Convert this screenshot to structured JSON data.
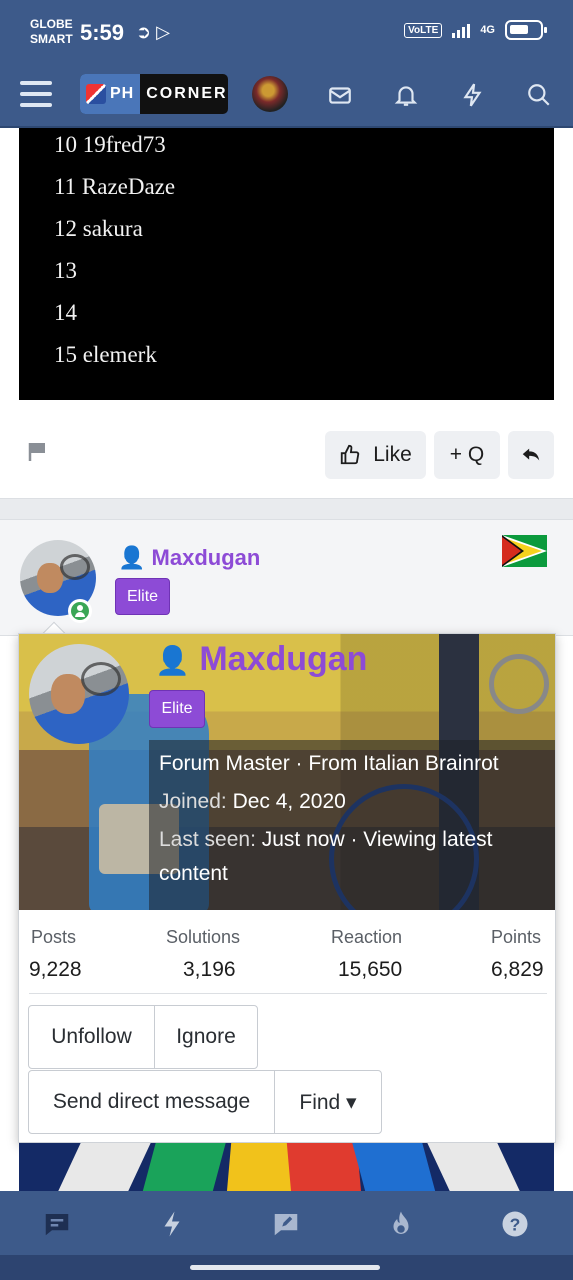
{
  "status_bar": {
    "carrier_line1": "GLOBE",
    "carrier_line2": "SMART",
    "time": "5:59",
    "volte": "VoLTE",
    "network": "4G"
  },
  "header": {
    "logo_left": "PH",
    "logo_right": "CORNER"
  },
  "post_list": [
    "10 19fred73",
    "11 RazeDaze",
    "12 sakura",
    "13",
    "14",
    "15 elemerk"
  ],
  "post_actions": {
    "like_label": "Like",
    "quote_label": "+ Q"
  },
  "next_post": {
    "username": "Maxdugan",
    "badge": "Elite",
    "country_flag": "guyana-flag"
  },
  "member_card": {
    "username": "Maxdugan",
    "badge": "Elite",
    "title_line": "Forum Master · From Italian Brainrot",
    "joined_label": "Joined:",
    "joined_value": "Dec 4, 2020",
    "last_seen_label": "Last seen:",
    "last_seen_value": "Just now · Viewing latest",
    "last_seen_cont": "content",
    "stats": [
      {
        "label": "Posts",
        "value": "9,228"
      },
      {
        "label": "Solutions",
        "value": "3,196"
      },
      {
        "label": "Reaction",
        "value": "15,650"
      },
      {
        "label": "Points",
        "value": "6,829"
      }
    ],
    "buttons": {
      "unfollow": "Unfollow",
      "ignore": "Ignore",
      "send_dm": "Send direct message",
      "find": "Find ▾"
    }
  },
  "colors": {
    "nav_bg": "#3d5a8a",
    "username": "#8d4bd6",
    "online": "#3aa655"
  },
  "bottom_nav": [
    "chat-icon",
    "lightning-icon",
    "write-icon",
    "fire-icon",
    "help-icon"
  ]
}
